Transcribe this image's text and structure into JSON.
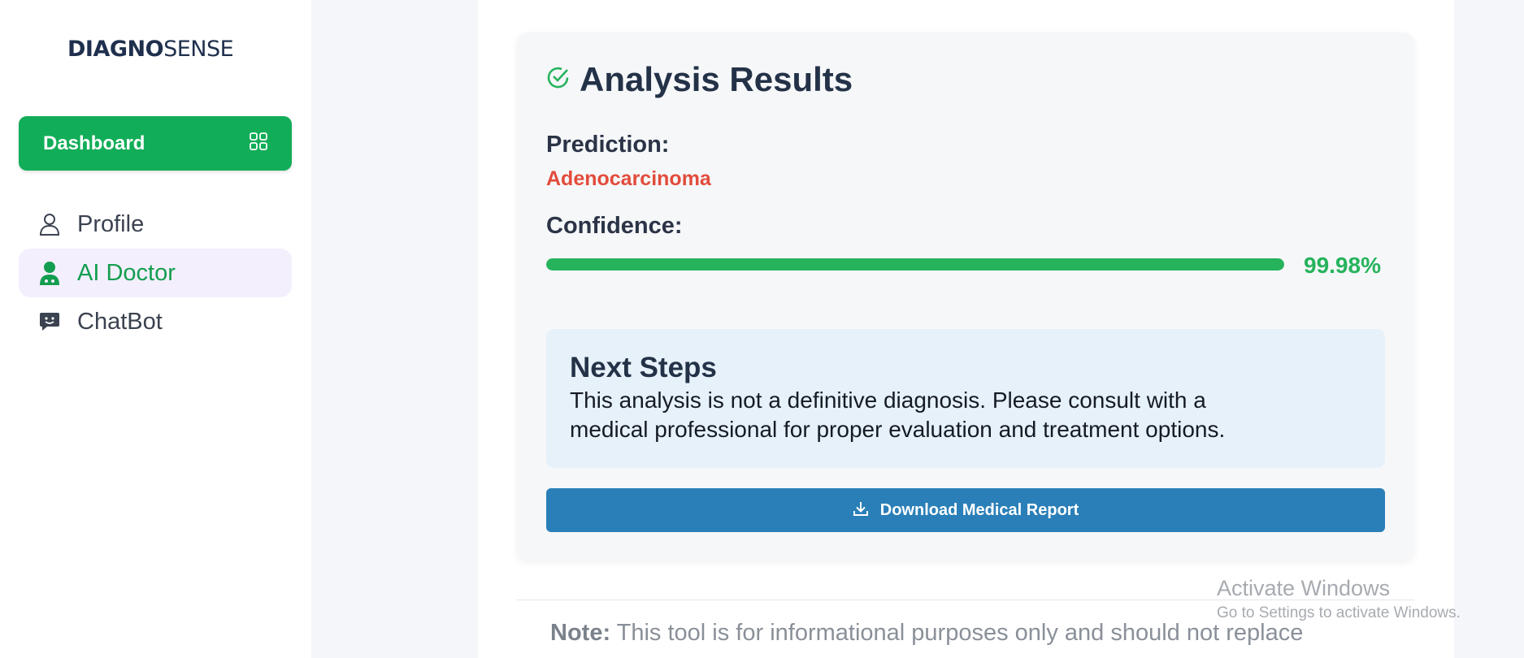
{
  "sidebar": {
    "logo_bold": "DIAGNO",
    "logo_regular": "SENSE",
    "dashboard_label": "Dashboard",
    "items": [
      {
        "label": "Profile",
        "icon": "user-icon"
      },
      {
        "label": "AI Doctor",
        "icon": "doctor-icon",
        "active": true
      },
      {
        "label": "ChatBot",
        "icon": "chat-icon"
      }
    ]
  },
  "results": {
    "title": "Analysis Results",
    "prediction_label": "Prediction:",
    "prediction_value": "Adenocarcinoma",
    "confidence_label": "Confidence:",
    "confidence_value": "99.98%",
    "confidence_fraction": 0.9998,
    "next_steps_title": "Next Steps",
    "next_steps_line1": "This analysis is not a definitive diagnosis. Please consult with a",
    "next_steps_line2": "medical professional for proper evaluation and treatment options.",
    "download_label": "Download Medical Report"
  },
  "note": {
    "bold": "Note:",
    "text": " This tool is for informational purposes only and should not replace"
  },
  "watermark": {
    "line1": "Activate Windows",
    "line2": "Go to Settings to activate Windows."
  },
  "colors": {
    "accent_green": "#12ad58",
    "prediction_red": "#e24c3b",
    "button_blue": "#2a7fb8"
  }
}
